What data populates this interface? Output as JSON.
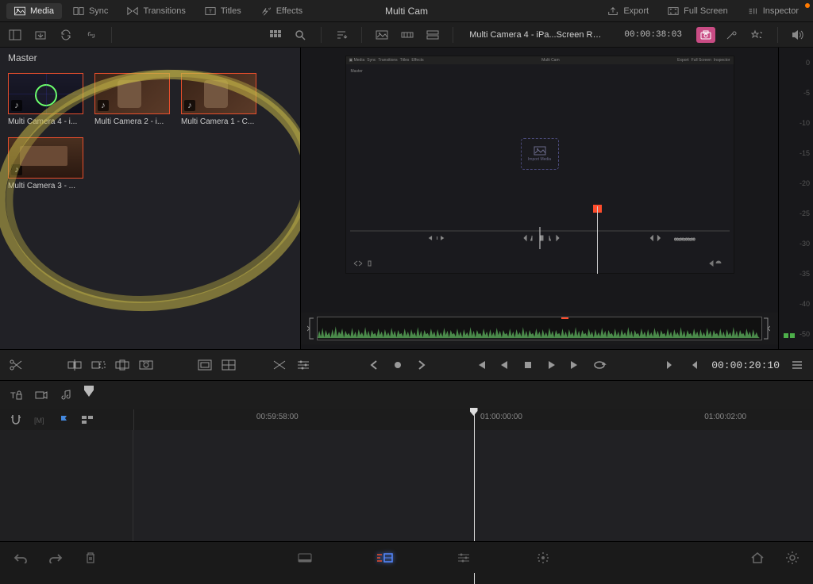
{
  "top_tabs": {
    "media": "Media",
    "sync": "Sync",
    "transitions": "Transitions",
    "titles": "Titles",
    "effects": "Effects"
  },
  "project_title": "Multi Cam",
  "top_right": {
    "export": "Export",
    "fullscreen": "Full Screen",
    "inspector": "Inspector"
  },
  "viewer": {
    "filename": "Multi Camera 4 - iPa...Screen Recording.MP4",
    "timecode": "00:00:38:03",
    "nested_import_label": "Import Media"
  },
  "media_pool": {
    "header": "Master",
    "clips": [
      {
        "label": "Multi Camera 4 - i..."
      },
      {
        "label": "Multi Camera 2 - i..."
      },
      {
        "label": "Multi Camera 1 - C..."
      },
      {
        "label": "Multi Camera 3 - ..."
      }
    ]
  },
  "meter_scale": [
    "0",
    "-5",
    "-10",
    "-15",
    "-20",
    "-25",
    "-30",
    "-35",
    "-40",
    "-50"
  ],
  "timeline": {
    "timecode": "00:00:20:10",
    "ruler": {
      "t0": "00:59:58:00",
      "t1": "01:00:00:00",
      "t2": "01:00:02:00"
    }
  }
}
